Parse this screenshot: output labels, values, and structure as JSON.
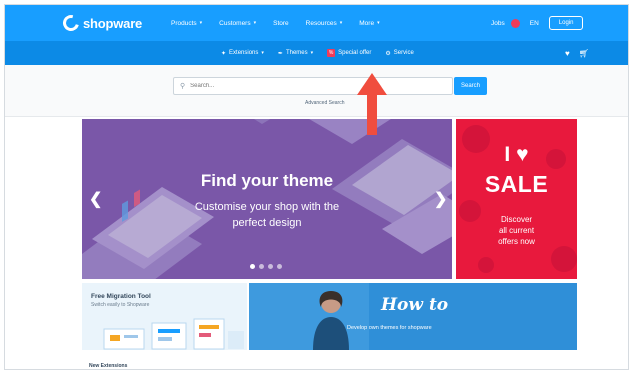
{
  "brand": {
    "logo_text": "shopware",
    "accent": "#189eff",
    "accent_dark": "#0c8ae6",
    "sale_color": "#e8193d",
    "arrow_color": "#f04d3e"
  },
  "topnav": {
    "items": [
      {
        "label": "Products",
        "has_caret": true
      },
      {
        "label": "Customers",
        "has_caret": true
      },
      {
        "label": "Store",
        "has_caret": false
      },
      {
        "label": "Resources",
        "has_caret": true
      },
      {
        "label": "More",
        "has_caret": true
      }
    ],
    "jobs_label": "Jobs",
    "language": "EN",
    "login_label": "Login"
  },
  "subnav": {
    "items": [
      {
        "label": "Extensions",
        "icon": "puzzle-icon",
        "has_caret": true
      },
      {
        "label": "Themes",
        "icon": "brush-icon",
        "has_caret": true
      },
      {
        "label": "Special offer",
        "icon": "offer-icon",
        "has_caret": false
      },
      {
        "label": "Service",
        "icon": "wrench-icon",
        "has_caret": false
      }
    ],
    "right_icons": [
      "heart-icon",
      "cart-icon"
    ]
  },
  "search": {
    "placeholder": "Search...",
    "button_label": "Search",
    "advanced_label": "Advanced Search"
  },
  "hero": {
    "title": "Find your theme",
    "subtitle_line1": "Customise your shop with the",
    "subtitle_line2": "perfect design",
    "slide_count": 4,
    "active_slide": 1
  },
  "sale": {
    "line1": "I ♥",
    "title": "SALE",
    "sub_line1": "Discover",
    "sub_line2": "all current",
    "sub_line3": "offers now"
  },
  "promos": {
    "migration_title": "Free Migration Tool",
    "migration_sub": "Switch easily to Shopware",
    "howto_title": "How to",
    "howto_sub": "Develop own themes for shopware"
  },
  "section_label": "New Extensions"
}
